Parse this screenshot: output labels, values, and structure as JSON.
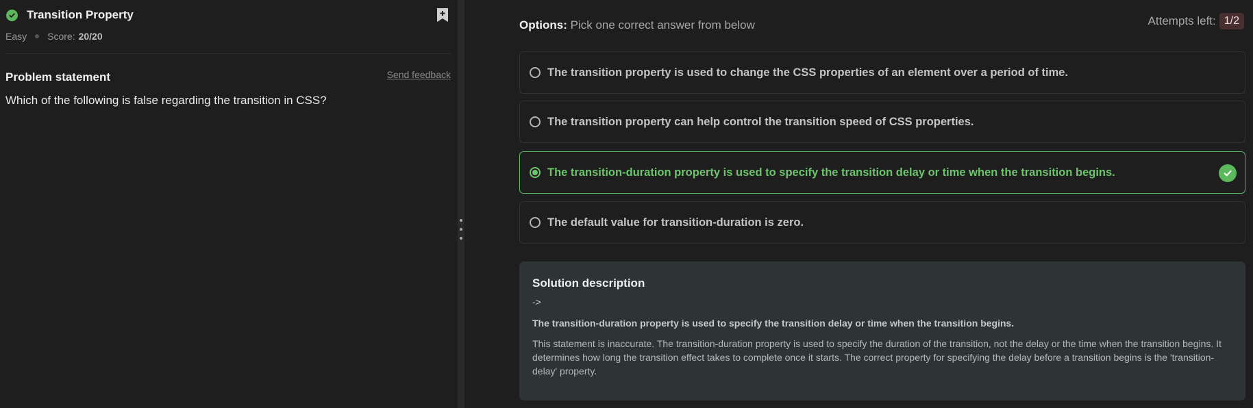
{
  "problem": {
    "title": "Transition Property",
    "difficulty": "Easy",
    "score_label": "Score:",
    "score_value": "20/20",
    "statement_heading": "Problem statement",
    "feedback_link": "Send feedback",
    "question": "Which of the following is false regarding the transition in CSS?"
  },
  "options_header": {
    "label_bold": "Options:",
    "label_text": "Pick one correct answer from below",
    "attempts_label": "Attempts left:",
    "attempts_value": "1/2"
  },
  "options": [
    {
      "text": "The transition property is used to change the CSS properties of an element over a period of time.",
      "selected": false
    },
    {
      "text": "The transition property can help control the transition speed of CSS properties.",
      "selected": false
    },
    {
      "text": "The transition-duration property is used to specify the transition delay or time when the transition begins.",
      "selected": true
    },
    {
      "text": "The default value for transition-duration is zero.",
      "selected": false
    }
  ],
  "solution": {
    "title": "Solution description",
    "arrow": "->",
    "bold_line": "The transition-duration property is used to specify the transition delay or time when the transition begins.",
    "body": "This statement is inaccurate. The transition-duration property is used to specify the duration of the transition, not the delay or the time when the transition begins. It determines how long the transition effect takes to complete once it starts. The correct property for specifying the delay before a transition begins is the 'transition-delay' property."
  },
  "colors": {
    "success": "#5cb85c",
    "attempts_badge_bg": "#4a2f30",
    "solution_bg": "#2c3436"
  },
  "icons": {
    "status": "check-circle-icon",
    "bookmark": "bookmark-add-icon",
    "correct": "check-circle-icon",
    "splitter": "drag-handle-icon"
  }
}
